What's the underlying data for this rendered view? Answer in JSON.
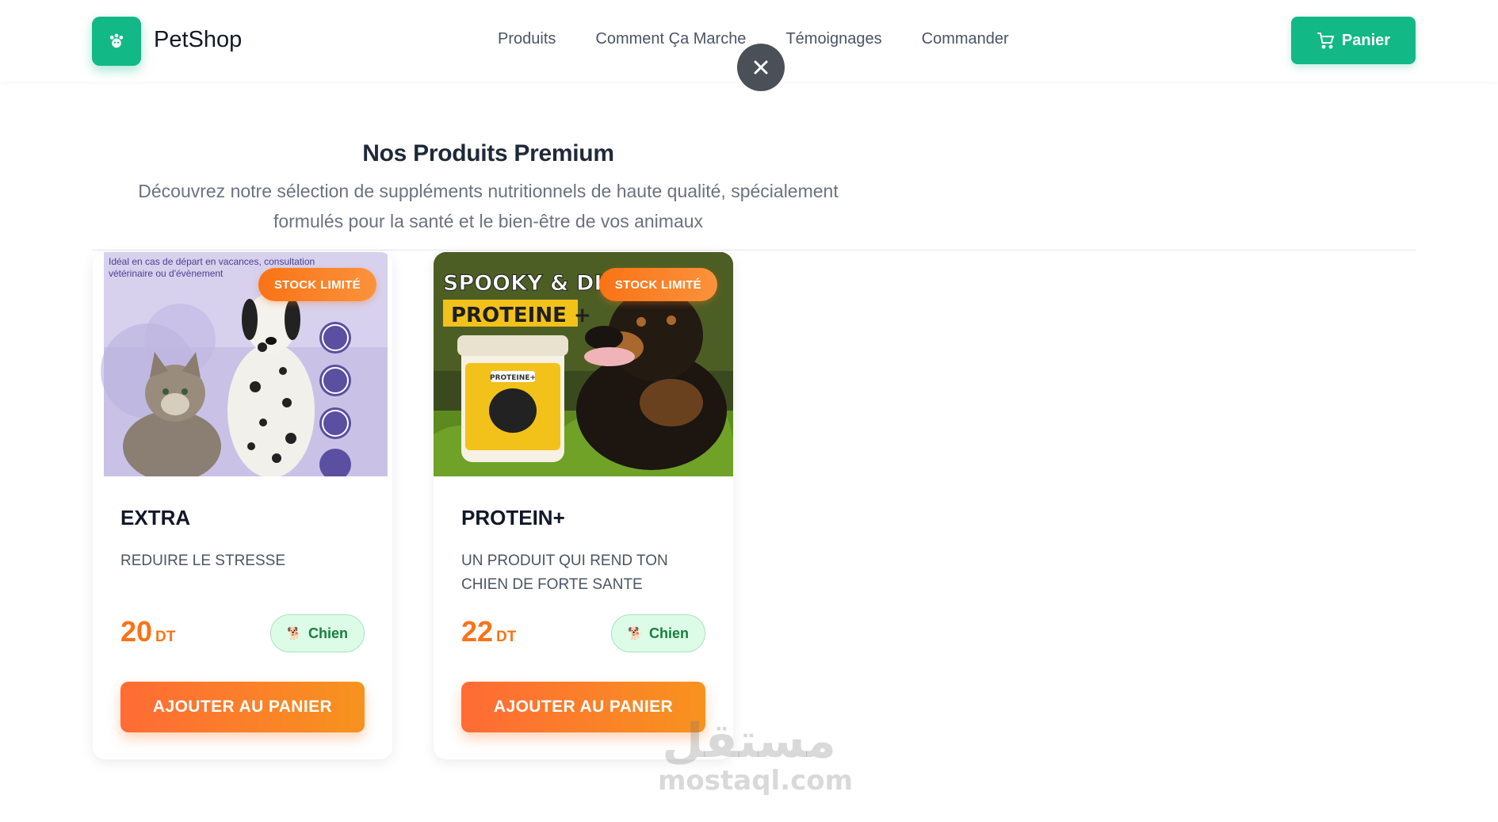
{
  "brand": {
    "name": "PetShop",
    "accent": "#12b886",
    "icon": "paw-icon"
  },
  "nav": {
    "items": [
      {
        "label": "Produits"
      },
      {
        "label": "Comment Ça Marche"
      },
      {
        "label": "Témoignages"
      },
      {
        "label": "Commander"
      }
    ]
  },
  "cart": {
    "label": "Panier",
    "icon": "cart-icon"
  },
  "overlay": {
    "close_icon": "close-icon"
  },
  "section": {
    "title": "Nos Produits Premium",
    "subtitle_line1": "Découvrez notre sélection de suppléments nutritionnels de haute qualité, spécialement",
    "subtitle_line2": "formulés pour la santé et le bien-être de vos animaux"
  },
  "products": [
    {
      "badge": "STOCK LIMITÉ",
      "image_text_line1": "Idéal en cas de départ en vacances, consultation",
      "image_text_line2": "vétérinaire ou d'évènement",
      "name": "EXTRA",
      "description": "REDUIRE LE STRESSE",
      "price": "20",
      "currency": "DT",
      "tag": "Chien",
      "button": "AJOUTER AU PANIER"
    },
    {
      "badge": "STOCK LIMITÉ",
      "image_text_line1": "SPOOKY & DIVA",
      "image_text_line2": "PROTEINE +",
      "image_jar_label": "PROTEINE+",
      "name": "PROTEIN+",
      "description": "UN PRODUIT QUI REND TON CHIEN DE FORTE SANTE",
      "price": "22",
      "currency": "DT",
      "tag": "Chien",
      "button": "AJOUTER AU PANIER"
    }
  ],
  "watermark": {
    "arabic": "مستقل",
    "latin": "mostaql.com"
  },
  "colors": {
    "accent_green": "#12b886",
    "accent_orange": "#f97316",
    "tag_green": "#15803d"
  }
}
